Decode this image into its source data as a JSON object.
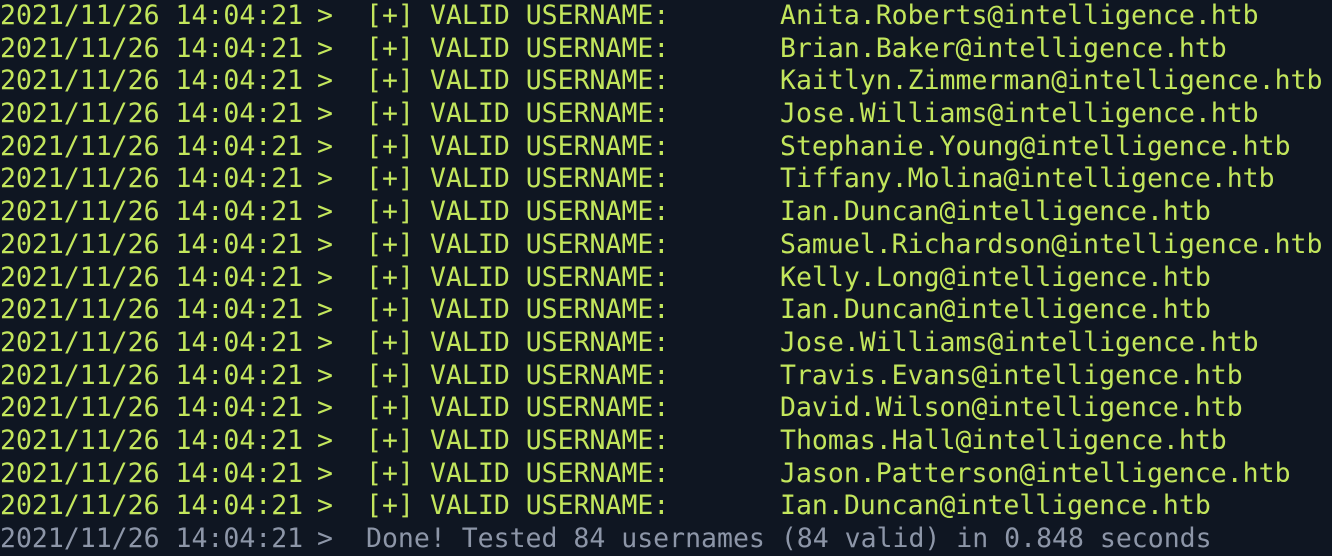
{
  "colors": {
    "background": "#0f1622",
    "valid_text": "#c3e65c",
    "done_text": "#8d96a8"
  },
  "prompt_symbol": ">",
  "status_tag": "[+]",
  "status_message": "VALID USERNAME:",
  "log_lines": [
    {
      "timestamp": "2021/11/26 14:04:21",
      "username": "Anita.Roberts@intelligence.htb"
    },
    {
      "timestamp": "2021/11/26 14:04:21",
      "username": "Brian.Baker@intelligence.htb"
    },
    {
      "timestamp": "2021/11/26 14:04:21",
      "username": "Kaitlyn.Zimmerman@intelligence.htb"
    },
    {
      "timestamp": "2021/11/26 14:04:21",
      "username": "Jose.Williams@intelligence.htb"
    },
    {
      "timestamp": "2021/11/26 14:04:21",
      "username": "Stephanie.Young@intelligence.htb"
    },
    {
      "timestamp": "2021/11/26 14:04:21",
      "username": "Tiffany.Molina@intelligence.htb"
    },
    {
      "timestamp": "2021/11/26 14:04:21",
      "username": "Ian.Duncan@intelligence.htb"
    },
    {
      "timestamp": "2021/11/26 14:04:21",
      "username": "Samuel.Richardson@intelligence.htb"
    },
    {
      "timestamp": "2021/11/26 14:04:21",
      "username": "Kelly.Long@intelligence.htb"
    },
    {
      "timestamp": "2021/11/26 14:04:21",
      "username": "Ian.Duncan@intelligence.htb"
    },
    {
      "timestamp": "2021/11/26 14:04:21",
      "username": "Jose.Williams@intelligence.htb"
    },
    {
      "timestamp": "2021/11/26 14:04:21",
      "username": "Travis.Evans@intelligence.htb"
    },
    {
      "timestamp": "2021/11/26 14:04:21",
      "username": "David.Wilson@intelligence.htb"
    },
    {
      "timestamp": "2021/11/26 14:04:21",
      "username": "Thomas.Hall@intelligence.htb"
    },
    {
      "timestamp": "2021/11/26 14:04:21",
      "username": "Jason.Patterson@intelligence.htb"
    },
    {
      "timestamp": "2021/11/26 14:04:21",
      "username": "Ian.Duncan@intelligence.htb"
    }
  ],
  "summary_line": {
    "timestamp": "2021/11/26 14:04:21",
    "message": "Done! Tested 84 usernames (84 valid) in 0.848 seconds"
  }
}
